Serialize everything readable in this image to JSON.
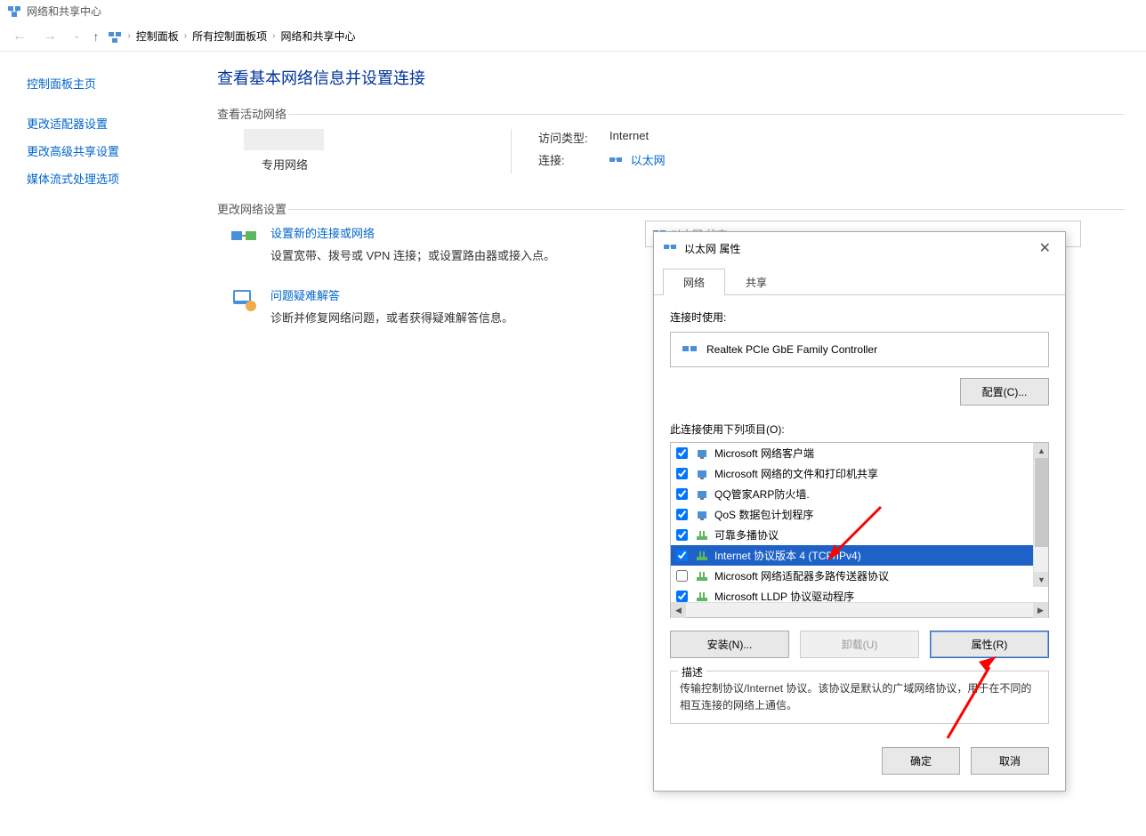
{
  "window_title": "网络和共享中心",
  "breadcrumb": {
    "items": [
      "控制面板",
      "所有控制面板项",
      "网络和共享中心"
    ]
  },
  "sidebar": {
    "items": [
      {
        "label": "控制面板主页"
      },
      {
        "label": "更改适配器设置"
      },
      {
        "label": "更改高级共享设置"
      },
      {
        "label": "媒体流式处理选项"
      }
    ]
  },
  "main": {
    "heading": "查看基本网络信息并设置连接",
    "section_active": "查看活动网络",
    "network_type": "专用网络",
    "access_type_label": "访问类型:",
    "access_type_value": "Internet",
    "connection_label": "连接:",
    "connection_value": "以太网",
    "section_change": "更改网络设置",
    "tasks": [
      {
        "title": "设置新的连接或网络",
        "desc": "设置宽带、拨号或 VPN 连接；或设置路由器或接入点。"
      },
      {
        "title": "问题疑难解答",
        "desc": "诊断并修复网络问题，或者获得疑难解答信息。"
      }
    ]
  },
  "behind_dialog_title": "以太网 状态",
  "dialog": {
    "title": "以太网 属性",
    "tabs": [
      "网络",
      "共享"
    ],
    "connect_using_label": "连接时使用:",
    "adapter_name": "Realtek PCIe GbE Family Controller",
    "configure_btn": "配置(C)...",
    "items_label": "此连接使用下列项目(O):",
    "items": [
      {
        "checked": true,
        "icon": "client",
        "label": "Microsoft 网络客户端"
      },
      {
        "checked": true,
        "icon": "client",
        "label": "Microsoft 网络的文件和打印机共享"
      },
      {
        "checked": true,
        "icon": "client",
        "label": "QQ管家ARP防火墙."
      },
      {
        "checked": true,
        "icon": "client",
        "label": "QoS 数据包计划程序"
      },
      {
        "checked": true,
        "icon": "proto",
        "label": "可靠多播协议"
      },
      {
        "checked": true,
        "icon": "proto",
        "label": "Internet 协议版本 4 (TCP/IPv4)",
        "selected": true
      },
      {
        "checked": false,
        "icon": "proto",
        "label": "Microsoft 网络适配器多路传送器协议"
      },
      {
        "checked": true,
        "icon": "proto",
        "label": "Microsoft LLDP 协议驱动程序"
      }
    ],
    "install_btn": "安装(N)...",
    "uninstall_btn": "卸载(U)",
    "properties_btn": "属性(R)",
    "desc_legend": "描述",
    "desc_text": "传输控制协议/Internet 协议。该协议是默认的广域网络协议，用于在不同的相互连接的网络上通信。",
    "ok_btn": "确定",
    "cancel_btn": "取消"
  }
}
